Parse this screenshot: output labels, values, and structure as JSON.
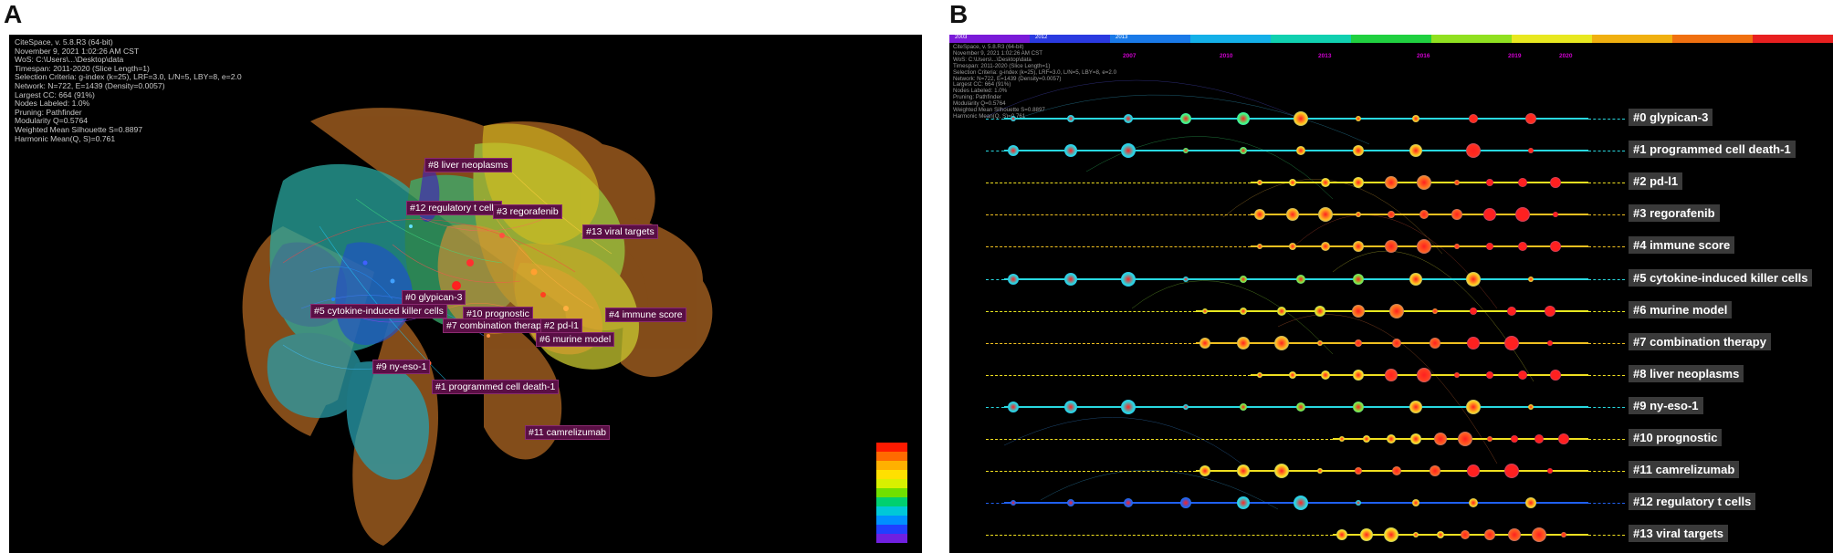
{
  "panels": {
    "a": {
      "letter": "A"
    },
    "b": {
      "letter": "B"
    }
  },
  "citespace_info": [
    "CiteSpace, v. 5.8.R3 (64-bit)",
    "November 9, 2021 1:02:26 AM CST",
    "WoS: C:\\Users\\...\\Desktop\\data",
    "Timespan: 2011-2020 (Slice Length=1)",
    "Selection Criteria: g-index (k=25), LRF=3.0, L/N=5, LBY=8, e=2.0",
    "Network: N=722, E=1439 (Density=0.0057)",
    "Largest CC: 664 (91%)",
    "Nodes Labeled: 1.0%",
    "Pruning: Pathfinder",
    "Modularity Q=0.5764",
    "Weighted Mean Silhouette S=0.8897",
    "Harmonic Mean(Q, S)=0.761"
  ],
  "cluster_labels_a": [
    "#8 liver neoplasms",
    "#12 regulatory t cells",
    "#3 regorafenib",
    "#13 viral targets",
    "#0 glypican-3",
    "#5 cytokine-induced killer cells",
    "#10 prognostic",
    "#7 combination therapy",
    "#2 pd-l1",
    "#4 immune score",
    "#6 murine model",
    "#9 ny-eso-1",
    "#1 programmed cell death-1",
    "#11 camrelizumab"
  ],
  "legend_colors": [
    "#ff1a00",
    "#ff6a00",
    "#ffb000",
    "#ffe000",
    "#d8f000",
    "#70e000",
    "#00d070",
    "#00c8d8",
    "#0090ff",
    "#2040ff",
    "#7020e0"
  ],
  "timeline": {
    "year_bar": [
      {
        "label": "2003",
        "color": "#7a1ad8"
      },
      {
        "label": "2012",
        "color": "#2a3ae0"
      },
      {
        "label": "2013",
        "color": "#1a7ae8"
      },
      {
        "label": "",
        "color": "#14b0e8"
      },
      {
        "label": "",
        "color": "#10d0b0"
      },
      {
        "label": "",
        "color": "#20d040"
      },
      {
        "label": "",
        "color": "#90e020"
      },
      {
        "label": "",
        "color": "#e8e820"
      },
      {
        "label": "",
        "color": "#f0b010"
      },
      {
        "label": "",
        "color": "#f07010"
      },
      {
        "label": "",
        "color": "#e82020"
      }
    ],
    "year_labels": [
      "2007",
      "2010",
      "2013",
      "2016",
      "2019",
      "2020"
    ],
    "clusters": [
      {
        "label": "#0 glypican-3",
        "color": "#28d8e0"
      },
      {
        "label": "#1 programmed cell death-1",
        "color": "#28d8e0"
      },
      {
        "label": "#2 pd-l1",
        "color": "#f0e020"
      },
      {
        "label": "#3 regorafenib",
        "color": "#f0c020"
      },
      {
        "label": "#4 immune score",
        "color": "#f0c020"
      },
      {
        "label": "#5 cytokine-induced killer cells",
        "color": "#28d8e0"
      },
      {
        "label": "#6 murine model",
        "color": "#e8e820"
      },
      {
        "label": "#7 combination therapy",
        "color": "#f0c020"
      },
      {
        "label": "#8 liver neoplasms",
        "color": "#f0e020"
      },
      {
        "label": "#9 ny-eso-1",
        "color": "#28d8e0"
      },
      {
        "label": "#10 prognostic",
        "color": "#f0e020"
      },
      {
        "label": "#11 camrelizumab",
        "color": "#f0e020"
      },
      {
        "label": "#12 regulatory t cells",
        "color": "#2060f0"
      },
      {
        "label": "#13 viral targets",
        "color": "#f0e020"
      }
    ]
  }
}
